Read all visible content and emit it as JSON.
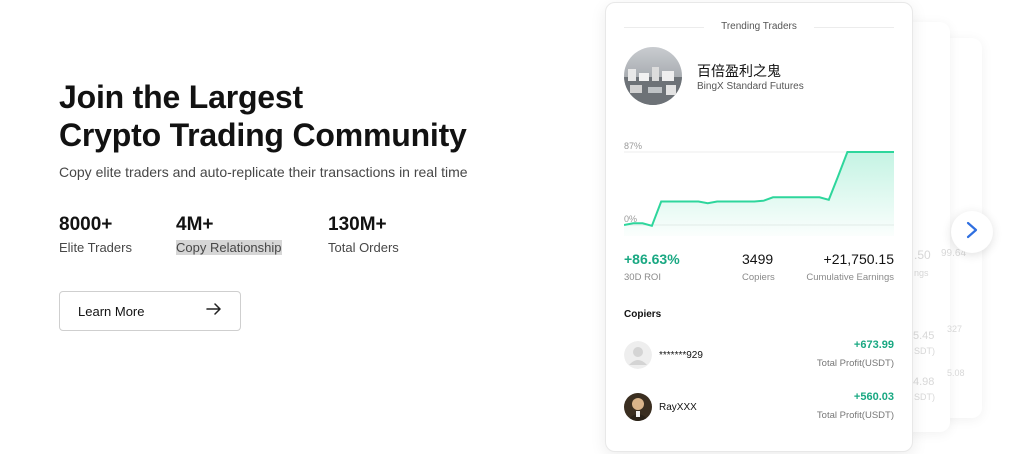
{
  "hero": {
    "title_line1": "Join the Largest",
    "title_line2": "Crypto Trading Community",
    "subtitle": "Copy elite traders and auto-replicate their transactions in real time"
  },
  "stats": [
    {
      "value": "8000+",
      "label": "Elite Traders"
    },
    {
      "value": "4M+",
      "label": "Copy Relationship"
    },
    {
      "value": "130M+",
      "label": "Total Orders"
    }
  ],
  "learn_more": {
    "label": "Learn More",
    "icon": "arrow-right-icon"
  },
  "card": {
    "title": "Trending Traders",
    "trader": {
      "name": "百倍盈利之鬼",
      "subtitle": "BingX Standard Futures"
    },
    "chart_data": {
      "type": "area",
      "y_ticks": [
        "87%",
        "0%"
      ],
      "color": "#2ed69c",
      "x": [
        0,
        1,
        2,
        3,
        4,
        5,
        6,
        7,
        8,
        9,
        10,
        11,
        12,
        13,
        14,
        15,
        16,
        17,
        18,
        19,
        20,
        21,
        22,
        23,
        24,
        25,
        26,
        27,
        28,
        29
      ],
      "values": [
        0,
        2,
        2,
        -1,
        28,
        28,
        28,
        28,
        28,
        26,
        28,
        28,
        28,
        28,
        28,
        29,
        33,
        33,
        33,
        33,
        33,
        33,
        30,
        58,
        87,
        87,
        87,
        87,
        87,
        87
      ]
    },
    "metrics": [
      {
        "value": "+86.63%",
        "label": "30D ROI",
        "color": "#19a882"
      },
      {
        "value": "3499",
        "label": "Copiers",
        "color": "#121212"
      },
      {
        "value": "+21,750.15",
        "label": "Cumulative Earnings",
        "color": "#121212"
      }
    ],
    "copiers_heading": "Copiers",
    "copiers": [
      {
        "name": "*******929",
        "profit": "+673.99",
        "profit_label": "Total Profit(USDT)",
        "avatar": "default-user-avatar-icon"
      },
      {
        "name": "RayXXX",
        "profit": "+560.03",
        "profit_label": "Total Profit(USDT)",
        "avatar": "portrait-avatar"
      }
    ]
  },
  "ghost_texts": [
    ".50",
    "99.64",
    "ngs",
    "5.45",
    "327",
    "SDT)",
    "4.98",
    "5.08",
    "SDT)"
  ],
  "next_button": {
    "icon": "chevron-right-icon",
    "color": "#2f6fe0"
  }
}
